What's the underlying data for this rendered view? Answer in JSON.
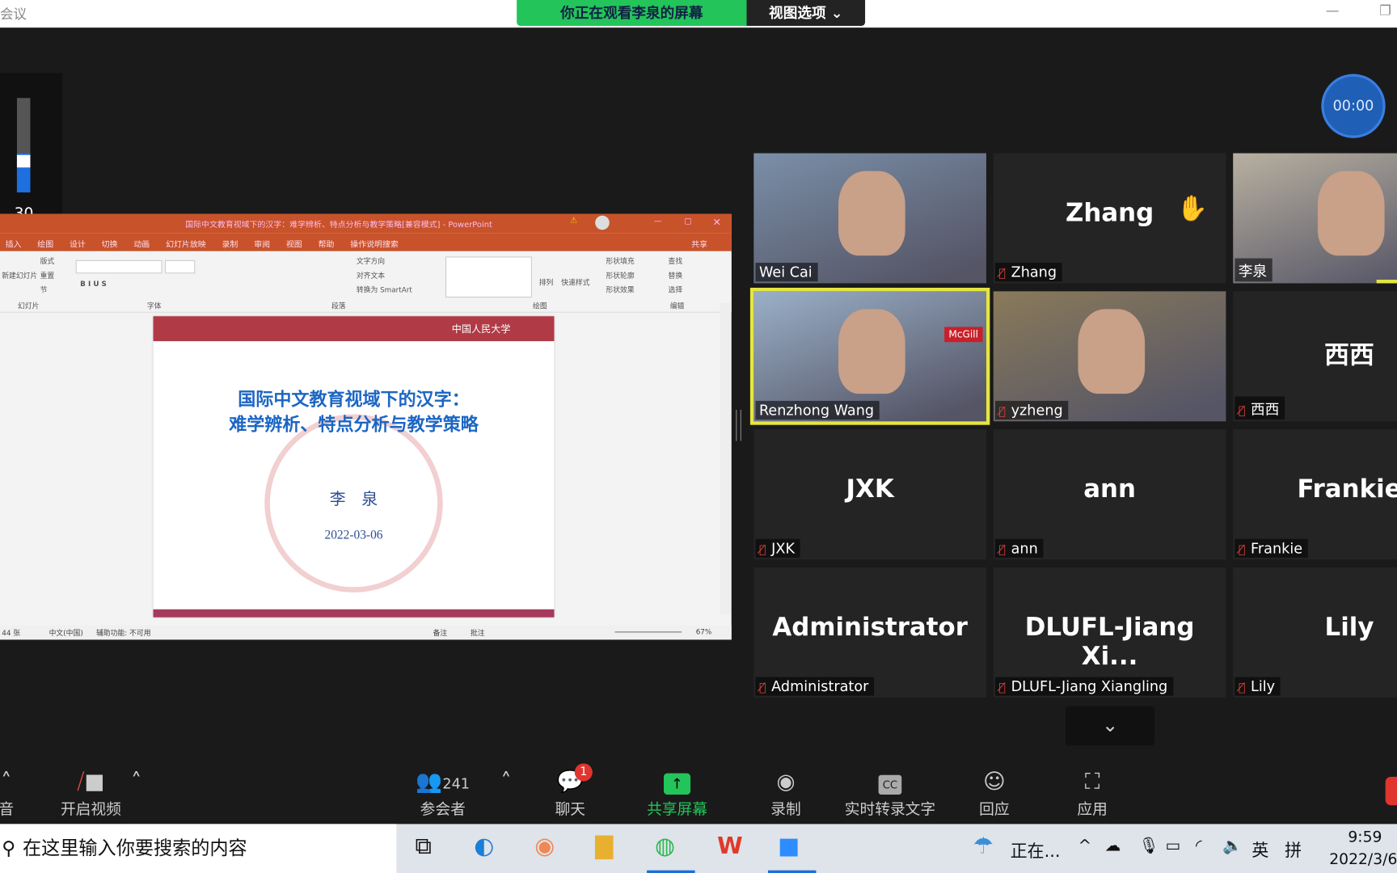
{
  "window": {
    "title": "会议",
    "banner": "你正在观看李泉的屏幕",
    "view_options": "视图选项"
  },
  "volume": {
    "level": 30,
    "label": "30"
  },
  "timer": "00:00",
  "ppt": {
    "title": "国际中文教育视域下的汉字：难学辨析、特点分析与教学策略[兼容模式] - PowerPoint",
    "share": "共享",
    "tabs": [
      "插入",
      "绘图",
      "设计",
      "切换",
      "动画",
      "幻灯片放映",
      "录制",
      "审阅",
      "视图",
      "帮助",
      "操作说明搜索"
    ],
    "groups": [
      "幻灯片",
      "字体",
      "段落",
      "绘图",
      "编辑"
    ],
    "ribbon_items": [
      "新建幻灯片",
      "版式",
      "重置",
      "节",
      "文字方向",
      "对齐文本",
      "转换为 SmartArt",
      "排列",
      "快速样式",
      "形状填充",
      "形状轮廓",
      "形状效果",
      "查找",
      "替换",
      "选择"
    ],
    "slide": {
      "logo": "中国人民大学",
      "title_line1": "国际中文教育视域下的汉字：",
      "title_line2": "难学辨析、特点分析与教学策略",
      "author": "李　泉",
      "date": "2022-03-06"
    },
    "status": {
      "slides": "44 张",
      "lang": "中文(中国)",
      "accessibility": "辅助功能: 不可用",
      "notes": "备注",
      "comments": "批注",
      "zoom": "67%"
    }
  },
  "participants": [
    {
      "name": "Wei Cai",
      "video": true,
      "muted": false
    },
    {
      "name": "Zhang",
      "video": false,
      "muted": true,
      "hand": true
    },
    {
      "name": "李泉",
      "video": true,
      "muted": false,
      "speaking": true
    },
    {
      "name": "Renzhong Wang",
      "video": true,
      "muted": false,
      "active": true,
      "badge": "McGill"
    },
    {
      "name": "yzheng",
      "video": true,
      "muted": true
    },
    {
      "name": "西西",
      "video": false,
      "muted": true
    },
    {
      "name": "JXK",
      "video": false,
      "muted": true
    },
    {
      "name": "ann",
      "video": false,
      "muted": true
    },
    {
      "name": "Frankie",
      "video": false,
      "muted": true
    },
    {
      "name": "Administrator",
      "video": false,
      "muted": true
    },
    {
      "name": "DLUFL-Jiang  Xiangling",
      "display": "DLUFL-Jiang  Xi...",
      "video": false,
      "muted": true
    },
    {
      "name": "Lily",
      "video": false,
      "muted": true
    }
  ],
  "toolbar": {
    "audio": "音",
    "video": "开启视频",
    "participants": "参会者",
    "participant_count": "241",
    "chat": "聊天",
    "chat_badge": "1",
    "share": "共享屏幕",
    "record": "录制",
    "cc": "实时转录文字",
    "reactions": "回应",
    "apps": "应用"
  },
  "taskbar": {
    "search_placeholder": "在这里输入你要搜索的内容",
    "weather": "正在...",
    "ime1": "英",
    "ime2": "拼",
    "time": "9:59",
    "date": "2022/3/6"
  },
  "colors": {
    "share_green": "#23c45a",
    "ppt_orange": "#c8522a",
    "active_speaker": "#e5e540"
  }
}
